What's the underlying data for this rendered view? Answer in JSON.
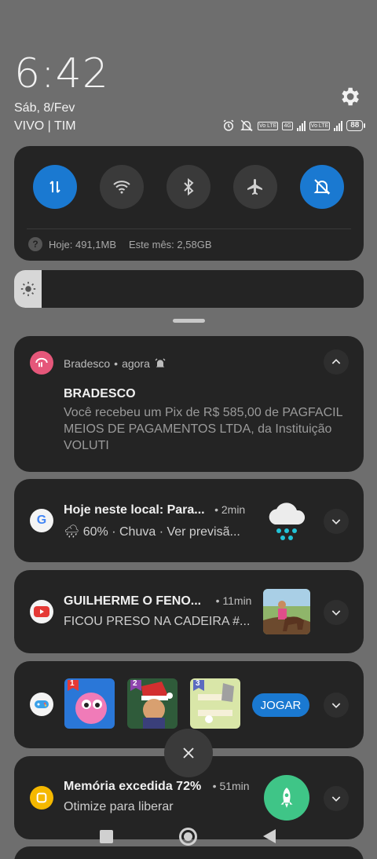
{
  "status": {
    "time": "6:42",
    "date": "Sáb, 8/Fev",
    "carrier": "VIVO | TIM",
    "battery": "88",
    "net_tag_1": "Vo LTE",
    "net_tag_4g": "4G",
    "net_tag_2": "Vo LTE"
  },
  "quick_settings": {
    "toggles": [
      {
        "name": "mobile-data",
        "on": true
      },
      {
        "name": "wifi",
        "on": false
      },
      {
        "name": "bluetooth",
        "on": false
      },
      {
        "name": "airplane",
        "on": false
      },
      {
        "name": "silent",
        "on": true
      }
    ],
    "usage_today": "Hoje: 491,1MB",
    "usage_month": "Este mês: 2,58GB",
    "brightness_level": 0.08
  },
  "notifications": {
    "bradesco": {
      "app": "Bradesco",
      "time": "agora",
      "title": "BRADESCO",
      "body": "Você recebeu um Pix de R$ 585,00 de PAGFACIL MEIOS DE PAGAMENTOS LTDA, da Instituição VOLUTI"
    },
    "google": {
      "title": "Hoje neste local: Para...",
      "time": "• 2min",
      "line": "🌧 60% · Chuva · Ver previsã..."
    },
    "youtube": {
      "title": "GUILHERME O FENO...",
      "time": "• 11min",
      "line": "FICOU PRESO NA CADEIRA #..."
    },
    "games": {
      "button": "JOGAR",
      "badges": [
        "1",
        "2",
        "3"
      ]
    },
    "memory": {
      "title": "Memória excedida 72%",
      "time": "• 51min",
      "line": "Otimize para liberar"
    }
  }
}
